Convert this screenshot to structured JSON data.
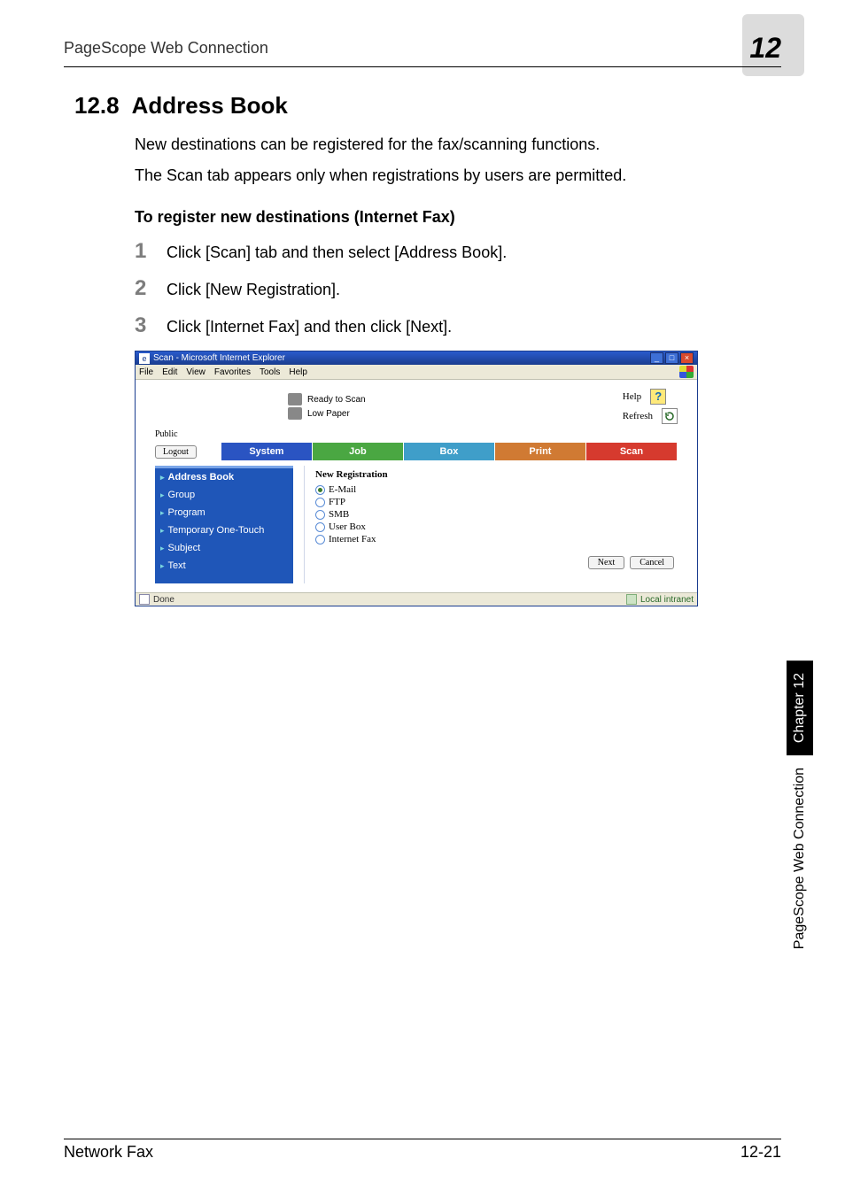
{
  "header": {
    "left": "PageScope Web Connection",
    "right": "12"
  },
  "section": {
    "number": "12.8",
    "title": "Address Book"
  },
  "paragraphs": {
    "p1": "New destinations can be registered for the fax/scanning functions.",
    "p2": "The Scan tab appears only when registrations by users are permitted."
  },
  "subheading": "To register new destinations (Internet Fax)",
  "steps": {
    "s1": {
      "num": "1",
      "text": "Click [Scan] tab and then select [Address Book]."
    },
    "s2": {
      "num": "2",
      "text": "Click [New Registration]."
    },
    "s3": {
      "num": "3",
      "text": "Click [Internet Fax] and then click [Next]."
    }
  },
  "ie": {
    "title": "Scan - Microsoft Internet Explorer",
    "menus": {
      "file": "File",
      "edit": "Edit",
      "view": "View",
      "favorites": "Favorites",
      "tools": "Tools",
      "help": "Help"
    },
    "status": {
      "ready": "Ready to Scan",
      "low": "Low Paper"
    },
    "help": {
      "help": "Help",
      "refresh": "Refresh"
    },
    "public": "Public",
    "logout": "Logout",
    "tabs": {
      "system": "System",
      "job": "Job",
      "box": "Box",
      "print": "Print",
      "scan": "Scan"
    },
    "sidebar": {
      "address": "Address Book",
      "group": "Group",
      "program": "Program",
      "temp": "Temporary One-Touch",
      "subject": "Subject",
      "text": "Text"
    },
    "pane": {
      "title": "New Registration",
      "opts": {
        "email": "E-Mail",
        "ftp": "FTP",
        "smb": "SMB",
        "userbox": "User Box",
        "ifax": "Internet Fax"
      },
      "next": "Next",
      "cancel": "Cancel"
    },
    "statusbar": {
      "done": "Done",
      "zone": "Local intranet"
    }
  },
  "sidetab": {
    "chapter": "Chapter 12",
    "name": "PageScope Web Connection"
  },
  "footer": {
    "left": "Network Fax",
    "right": "12-21"
  }
}
